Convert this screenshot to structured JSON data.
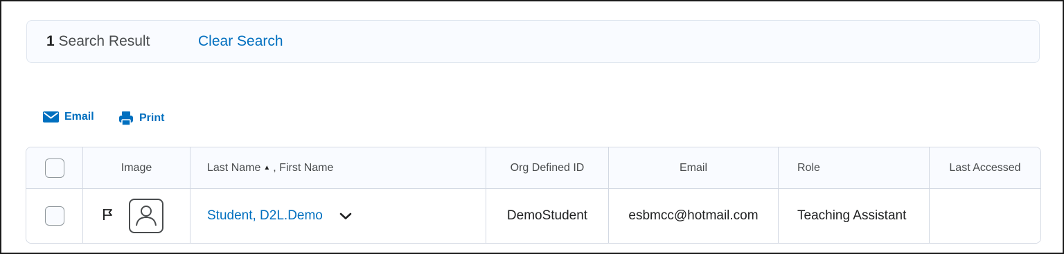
{
  "search": {
    "count": "1",
    "result_label": "Search Result",
    "clear_label": "Clear Search"
  },
  "toolbar": {
    "email_label": "Email",
    "print_label": "Print"
  },
  "table": {
    "headers": {
      "image": "Image",
      "last_name": "Last Name",
      "first_name": ", First Name",
      "sort_indicator": "▲",
      "org_id": "Org Defined ID",
      "email": "Email",
      "role": "Role",
      "last_accessed": "Last Accessed"
    },
    "rows": [
      {
        "name": "Student, D2L.Demo",
        "org_id": "DemoStudent",
        "email": "esbmcc@hotmail.com",
        "role": "Teaching Assistant",
        "last_accessed": ""
      }
    ]
  },
  "colors": {
    "link": "#006fbf",
    "border": "#d3d9e3",
    "header_bg": "#f9fbff"
  }
}
